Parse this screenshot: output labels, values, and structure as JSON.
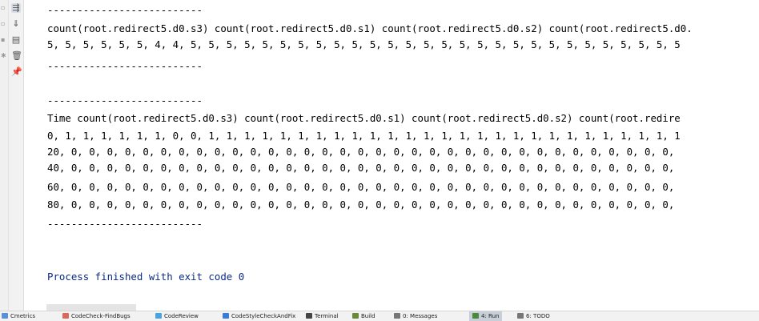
{
  "console": {
    "lines": [
      "--------------------------",
      "count(root.redirect5.d0.s3) count(root.redirect5.d0.s1) count(root.redirect5.d0.s2) count(root.redirect5.d0.",
      "5, 5, 5, 5, 5, 5, 4, 4, 5, 5, 5, 5, 5, 5, 5, 5, 5, 5, 5, 5, 5, 5, 5, 5, 5, 5, 5, 5, 5, 5, 5, 5, 5, 5, 5, 5",
      "--------------------------",
      "",
      "",
      "--------------------------",
      "Time count(root.redirect5.d0.s3) count(root.redirect5.d0.s1) count(root.redirect5.d0.s2) count(root.redire",
      "0, 1, 1, 1, 1, 1, 1, 0, 0, 1, 1, 1, 1, 1, 1, 1, 1, 1, 1, 1, 1, 1, 1, 1, 1, 1, 1, 1, 1, 1, 1, 1, 1, 1, 1, 1",
      "20, 0, 0, 0, 0, 0, 0, 0, 0, 0, 0, 0, 0, 0, 0, 0, 0, 0, 0, 0, 0, 0, 0, 0, 0, 0, 0, 0, 0, 0, 0, 0, 0, 0, 0,",
      "40, 0, 0, 0, 0, 0, 0, 0, 0, 0, 0, 0, 0, 0, 0, 0, 0, 0, 0, 0, 0, 0, 0, 0, 0, 0, 0, 0, 0, 0, 0, 0, 0, 0, 0,",
      "60, 0, 0, 0, 0, 0, 0, 0, 0, 0, 0, 0, 0, 0, 0, 0, 0, 0, 0, 0, 0, 0, 0, 0, 0, 0, 0, 0, 0, 0, 0, 0, 0, 0, 0,",
      "80, 0, 0, 0, 0, 0, 0, 0, 0, 0, 0, 0, 0, 0, 0, 0, 0, 0, 0, 0, 0, 0, 0, 0, 0, 0, 0, 0, 0, 0, 0, 0, 0, 0, 0,",
      "--------------------------",
      "",
      "",
      "",
      "Process finished with exit code 0"
    ]
  },
  "toolstrip": {
    "icons": [
      "soft-wrap-icon",
      "scroll-to-end-icon",
      "print-icon",
      "clear-all-icon",
      "pin-tab-icon"
    ]
  },
  "statusbar": {
    "items": [
      {
        "label": "Cmetrics",
        "icon": "cmetrics-icon",
        "color": "#5b8fd6"
      },
      {
        "label": "CodeCheck-FindBugs",
        "icon": "findbugs-icon",
        "color": "#d96b5a"
      },
      {
        "label": "CodeReview",
        "icon": "codereview-icon",
        "color": "#4aa3df"
      },
      {
        "label": "CodeStyleCheckAndFix",
        "icon": "codestyle-icon",
        "color": "#3a7bd5"
      },
      {
        "label": "Terminal",
        "icon": "terminal-icon",
        "color": "#444444"
      },
      {
        "label": "Build",
        "icon": "build-icon",
        "color": "#6a8a3a"
      },
      {
        "label": "0: Messages",
        "icon": "messages-icon",
        "color": "#777777"
      },
      {
        "label": "4: Run",
        "icon": "run-icon",
        "color": "#4a8a3a",
        "active": true
      },
      {
        "label": "6: TODO",
        "icon": "todo-icon",
        "color": "#777777"
      }
    ]
  }
}
